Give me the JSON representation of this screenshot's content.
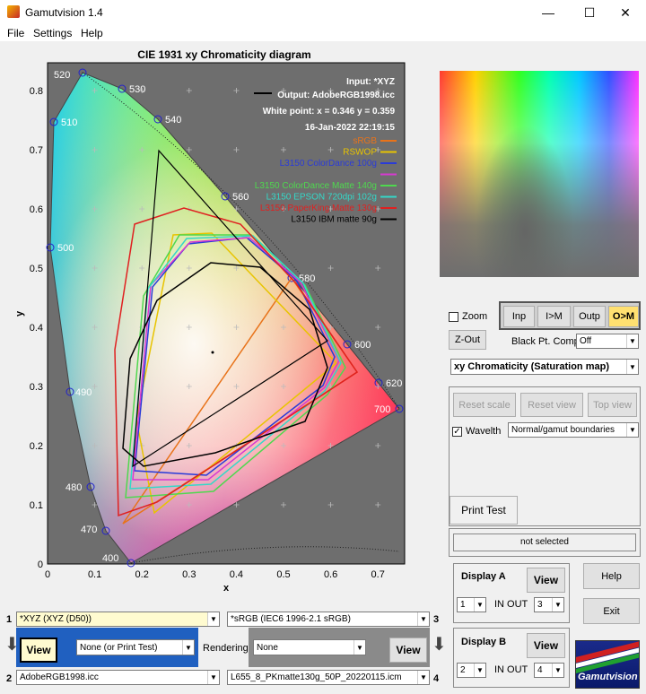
{
  "window": {
    "title": "Gamutvision 1.4"
  },
  "menu": [
    "File",
    "Settings",
    "Help"
  ],
  "plot": {
    "title": "CIE 1931 xy Chromaticity diagram",
    "xlabel": "x",
    "ylabel": "y",
    "xticks": [
      "0",
      "0.1",
      "0.2",
      "0.3",
      "0.4",
      "0.5",
      "0.6",
      "0.7"
    ],
    "yticks": [
      "0",
      "0.1",
      "0.2",
      "0.3",
      "0.4",
      "0.5",
      "0.6",
      "0.7",
      "0.8"
    ],
    "info": {
      "input": "Input:  *XYZ",
      "output": "Output: AdobeRGB1998.icc",
      "white_point": "White point:  x = 0.346  y = 0.359",
      "timestamp": "16-Jan-2022 22:19:15"
    },
    "wavelengths": [
      "400",
      "470",
      "480",
      "490",
      "500",
      "510",
      "520",
      "530",
      "540",
      "560",
      "580",
      "600",
      "620",
      "700"
    ],
    "legend": [
      {
        "name": "sRGB",
        "color": "#e8731a"
      },
      {
        "name": "RSWOP",
        "color": "#e8c400"
      },
      {
        "name": "L3150 ColorDance 100g",
        "color": "#2a3bd8"
      },
      {
        "name": "",
        "color": "#d63ad0"
      },
      {
        "name": "L3150 ColorDance Matte 140g",
        "color": "#4fd84f"
      },
      {
        "name": "L3150 EPSON 720dpi  102g",
        "color": "#34d8c8"
      },
      {
        "name": "L3150 PaperKing Matte 130g",
        "color": "#e02020"
      },
      {
        "name": "L3150 IBM matte 90g",
        "color": "#000000"
      }
    ]
  },
  "controls": {
    "zoom_label": "Zoom",
    "zout_label": "Z-Out",
    "mode_buttons": [
      "Inp",
      "I>M",
      "Outp",
      "O>M"
    ],
    "black_pt_label": "Black Pt. Comp.",
    "black_pt_value": "Off",
    "display_select": "xy Chromaticity (Saturation map)",
    "reset_scale": "Reset scale",
    "reset_view": "Reset view",
    "top_view": "Top view",
    "wavelth_label": "Wavelth",
    "boundaries_select": "Normal/gamut boundaries",
    "print_test": "Print Test",
    "status": "not selected",
    "display_a": "Display A",
    "display_b": "Display B",
    "view_label": "View",
    "in_out_label": "IN  OUT",
    "disp_a_in": "1",
    "disp_a_out": "3",
    "disp_b_in": "2",
    "disp_b_out": "4",
    "help": "Help",
    "exit": "Exit",
    "logo_text": "Gamutvision"
  },
  "files": {
    "f1_num": "1",
    "f1": "*XYZ      (XYZ (D50))",
    "f2_num": "2",
    "f2": "AdobeRGB1998.icc",
    "f3_num": "3",
    "f3": "*sRGB   (IEC6 1996-2.1 sRGB)",
    "f4_num": "4",
    "f4": "L655_8_PKmatte130g_50P_20220115.icm",
    "rendering_label": "Rendering",
    "intent_left": "None (or Print Test)",
    "intent_right": "None",
    "view_label": "View"
  }
}
